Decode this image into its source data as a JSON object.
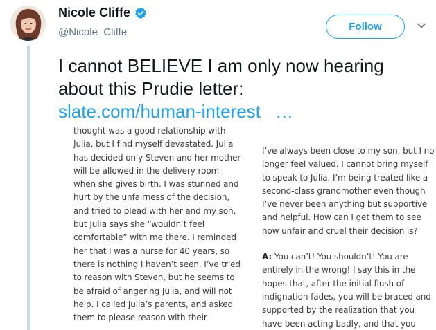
{
  "author": {
    "name": "Nicole Cliffe",
    "handle": "@Nicole_Cliffe"
  },
  "follow_label": "Follow",
  "tweet": {
    "text": "I cannot BELIEVE I am only now hearing about this Prudie letter:",
    "link": "slate.com/human-interest",
    "ellipsis": "…"
  },
  "image": {
    "left_lines": [
      "thought was a good relationship with",
      "Julia, but I find myself devastated. Julia",
      "has decided only Steven and her mother",
      "will be allowed in the delivery room",
      "when she gives birth. I was stunned and",
      "hurt by the unfairness of the decision,",
      "and tried to plead with her and my son,",
      "but Julia says she “wouldn’t feel",
      "comfortable” with me there. I reminded",
      "her that I was a nurse for 40 years, so",
      "there is nothing I haven’t seen. I’ve tried",
      "to reason with Steven, but he seems to",
      "be afraid of angering Julia, and will not",
      "help. I called Julia’s parents, and asked",
      "them to please reason with their"
    ],
    "right_lines_a": [
      "I’ve always been close to my son, but I no",
      "longer feel valued. I cannot bring myself",
      "to speak to Julia. I’m being treated like a",
      "second-class grandmother even though",
      "I’ve never been anything but supportive",
      "and helpful. How can I get them to see",
      "how unfair and cruel their decision is?"
    ],
    "answer_label": "A:",
    "right_first_line_rest": " You can’t! You shouldn’t! You are",
    "right_lines_b": [
      "entirely in the wrong! I say this in the",
      "hopes that, after the initial flush of",
      "indignation fades, you will be braced and",
      "supported by the realization that you",
      "have been acting badly, and that you"
    ]
  }
}
